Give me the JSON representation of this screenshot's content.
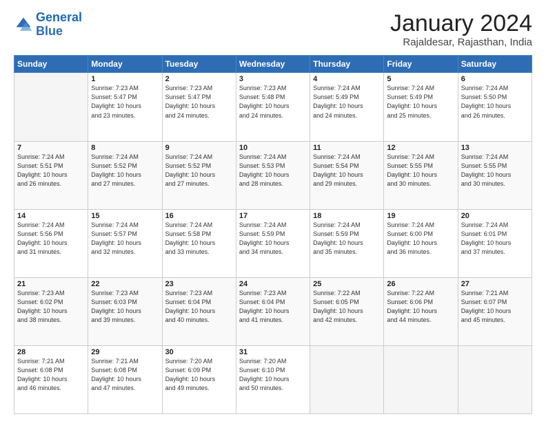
{
  "logo": {
    "line1": "General",
    "line2": "Blue"
  },
  "title": "January 2024",
  "subtitle": "Rajaldesar, Rajasthan, India",
  "headers": [
    "Sunday",
    "Monday",
    "Tuesday",
    "Wednesday",
    "Thursday",
    "Friday",
    "Saturday"
  ],
  "weeks": [
    [
      {
        "num": "",
        "info": ""
      },
      {
        "num": "1",
        "info": "Sunrise: 7:23 AM\nSunset: 5:47 PM\nDaylight: 10 hours\nand 23 minutes."
      },
      {
        "num": "2",
        "info": "Sunrise: 7:23 AM\nSunset: 5:47 PM\nDaylight: 10 hours\nand 24 minutes."
      },
      {
        "num": "3",
        "info": "Sunrise: 7:23 AM\nSunset: 5:48 PM\nDaylight: 10 hours\nand 24 minutes."
      },
      {
        "num": "4",
        "info": "Sunrise: 7:24 AM\nSunset: 5:49 PM\nDaylight: 10 hours\nand 24 minutes."
      },
      {
        "num": "5",
        "info": "Sunrise: 7:24 AM\nSunset: 5:49 PM\nDaylight: 10 hours\nand 25 minutes."
      },
      {
        "num": "6",
        "info": "Sunrise: 7:24 AM\nSunset: 5:50 PM\nDaylight: 10 hours\nand 26 minutes."
      }
    ],
    [
      {
        "num": "7",
        "info": "Sunrise: 7:24 AM\nSunset: 5:51 PM\nDaylight: 10 hours\nand 26 minutes."
      },
      {
        "num": "8",
        "info": "Sunrise: 7:24 AM\nSunset: 5:52 PM\nDaylight: 10 hours\nand 27 minutes."
      },
      {
        "num": "9",
        "info": "Sunrise: 7:24 AM\nSunset: 5:52 PM\nDaylight: 10 hours\nand 27 minutes."
      },
      {
        "num": "10",
        "info": "Sunrise: 7:24 AM\nSunset: 5:53 PM\nDaylight: 10 hours\nand 28 minutes."
      },
      {
        "num": "11",
        "info": "Sunrise: 7:24 AM\nSunset: 5:54 PM\nDaylight: 10 hours\nand 29 minutes."
      },
      {
        "num": "12",
        "info": "Sunrise: 7:24 AM\nSunset: 5:55 PM\nDaylight: 10 hours\nand 30 minutes."
      },
      {
        "num": "13",
        "info": "Sunrise: 7:24 AM\nSunset: 5:55 PM\nDaylight: 10 hours\nand 30 minutes."
      }
    ],
    [
      {
        "num": "14",
        "info": "Sunrise: 7:24 AM\nSunset: 5:56 PM\nDaylight: 10 hours\nand 31 minutes."
      },
      {
        "num": "15",
        "info": "Sunrise: 7:24 AM\nSunset: 5:57 PM\nDaylight: 10 hours\nand 32 minutes."
      },
      {
        "num": "16",
        "info": "Sunrise: 7:24 AM\nSunset: 5:58 PM\nDaylight: 10 hours\nand 33 minutes."
      },
      {
        "num": "17",
        "info": "Sunrise: 7:24 AM\nSunset: 5:59 PM\nDaylight: 10 hours\nand 34 minutes."
      },
      {
        "num": "18",
        "info": "Sunrise: 7:24 AM\nSunset: 5:59 PM\nDaylight: 10 hours\nand 35 minutes."
      },
      {
        "num": "19",
        "info": "Sunrise: 7:24 AM\nSunset: 6:00 PM\nDaylight: 10 hours\nand 36 minutes."
      },
      {
        "num": "20",
        "info": "Sunrise: 7:24 AM\nSunset: 6:01 PM\nDaylight: 10 hours\nand 37 minutes."
      }
    ],
    [
      {
        "num": "21",
        "info": "Sunrise: 7:23 AM\nSunset: 6:02 PM\nDaylight: 10 hours\nand 38 minutes."
      },
      {
        "num": "22",
        "info": "Sunrise: 7:23 AM\nSunset: 6:03 PM\nDaylight: 10 hours\nand 39 minutes."
      },
      {
        "num": "23",
        "info": "Sunrise: 7:23 AM\nSunset: 6:04 PM\nDaylight: 10 hours\nand 40 minutes."
      },
      {
        "num": "24",
        "info": "Sunrise: 7:23 AM\nSunset: 6:04 PM\nDaylight: 10 hours\nand 41 minutes."
      },
      {
        "num": "25",
        "info": "Sunrise: 7:22 AM\nSunset: 6:05 PM\nDaylight: 10 hours\nand 42 minutes."
      },
      {
        "num": "26",
        "info": "Sunrise: 7:22 AM\nSunset: 6:06 PM\nDaylight: 10 hours\nand 44 minutes."
      },
      {
        "num": "27",
        "info": "Sunrise: 7:21 AM\nSunset: 6:07 PM\nDaylight: 10 hours\nand 45 minutes."
      }
    ],
    [
      {
        "num": "28",
        "info": "Sunrise: 7:21 AM\nSunset: 6:08 PM\nDaylight: 10 hours\nand 46 minutes."
      },
      {
        "num": "29",
        "info": "Sunrise: 7:21 AM\nSunset: 6:08 PM\nDaylight: 10 hours\nand 47 minutes."
      },
      {
        "num": "30",
        "info": "Sunrise: 7:20 AM\nSunset: 6:09 PM\nDaylight: 10 hours\nand 49 minutes."
      },
      {
        "num": "31",
        "info": "Sunrise: 7:20 AM\nSunset: 6:10 PM\nDaylight: 10 hours\nand 50 minutes."
      },
      {
        "num": "",
        "info": ""
      },
      {
        "num": "",
        "info": ""
      },
      {
        "num": "",
        "info": ""
      }
    ]
  ]
}
